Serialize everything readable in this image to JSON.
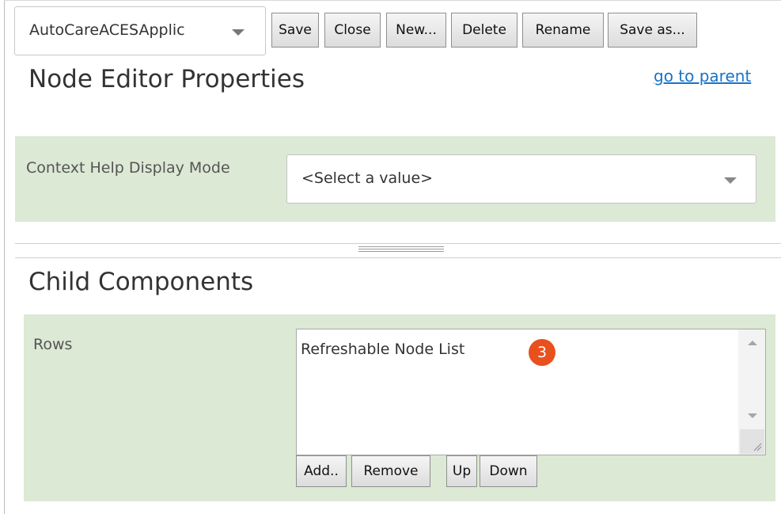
{
  "toolbar": {
    "editor_selector": {
      "value": "AutoCareACESApplic",
      "icon": "chevron-down-icon"
    },
    "buttons": {
      "save": "Save",
      "close": "Close",
      "new": "New...",
      "delete": "Delete",
      "rename": "Rename",
      "save_as": "Save as..."
    }
  },
  "header": {
    "title": "Node Editor Properties",
    "parent_link": "go to parent"
  },
  "properties": {
    "context_help": {
      "label": "Context Help Display Mode",
      "select_value": "<Select a value>"
    }
  },
  "child_components": {
    "title": "Child Components",
    "rows": {
      "label": "Rows",
      "items": [
        "Refreshable Node List"
      ],
      "badge": "3",
      "buttons": {
        "add": "Add..",
        "remove": "Remove",
        "up": "Up",
        "down": "Down"
      }
    }
  },
  "colors": {
    "panel_background": "#dce9d5",
    "link": "#1a73c8",
    "badge": "#e8501d"
  }
}
